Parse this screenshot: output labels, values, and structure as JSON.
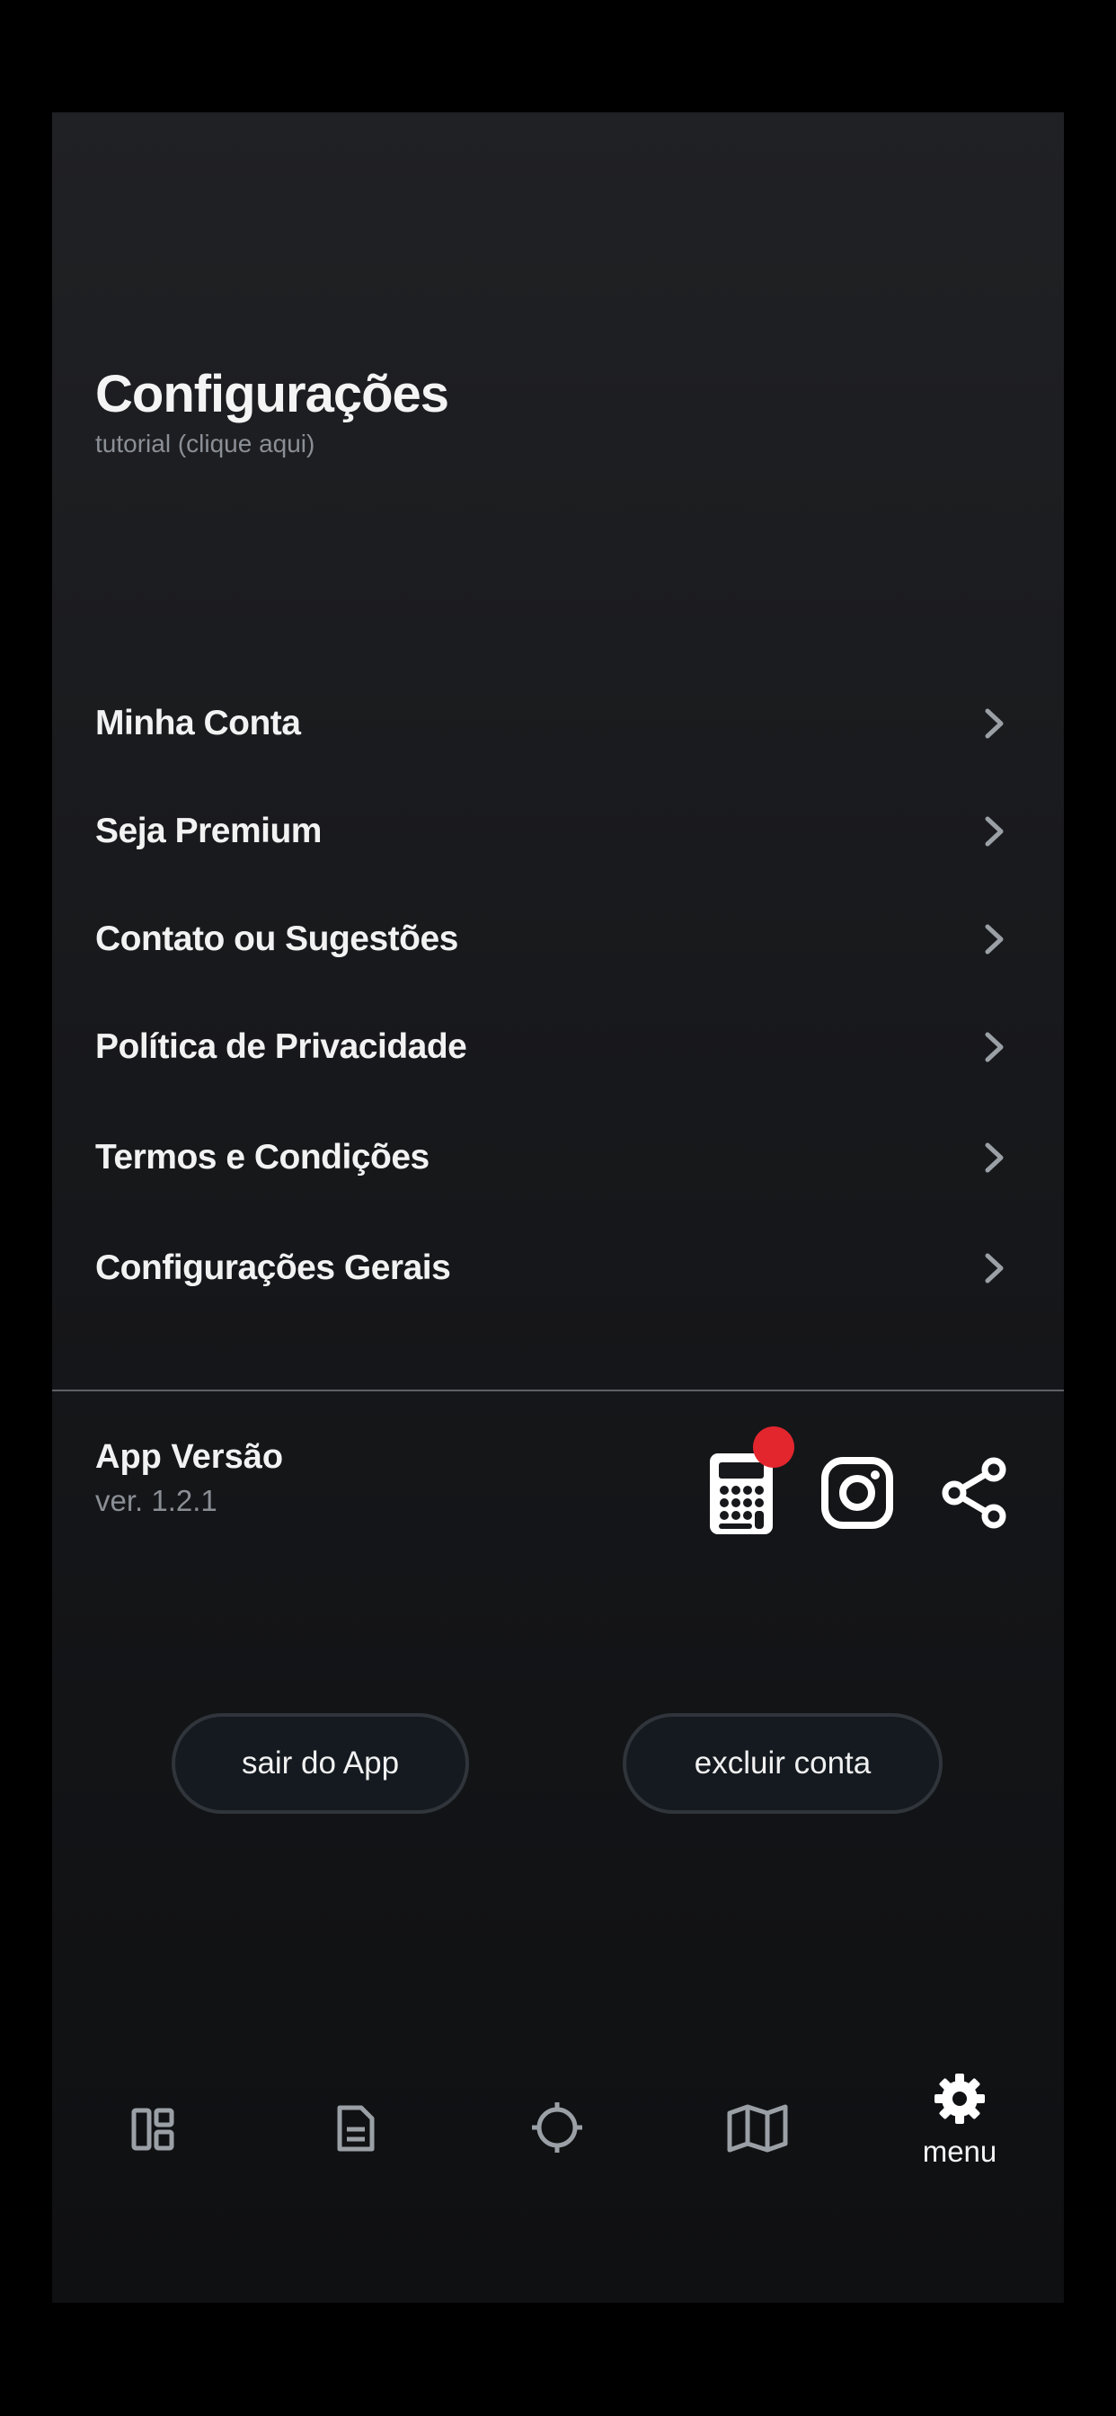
{
  "header": {
    "title": "Configurações",
    "subtitle": "tutorial (clique aqui)"
  },
  "menu": {
    "items": [
      {
        "label": "Minha Conta"
      },
      {
        "label": "Seja Premium"
      },
      {
        "label": "Contato ou Sugestões"
      },
      {
        "label": "Política de Privacidade"
      },
      {
        "label": "Termos e Condições"
      },
      {
        "label": "Configurações Gerais"
      }
    ]
  },
  "version": {
    "title": "App Versão",
    "value": "ver. 1.2.1"
  },
  "actions": {
    "logout_label": "sair do App",
    "delete_label": "excluir conta"
  },
  "social": {
    "icons": [
      "calculator-icon",
      "instagram-icon",
      "share-icon"
    ],
    "badge_color": "#e3262e"
  },
  "bottom_nav": {
    "items": [
      {
        "icon": "dashboard-icon"
      },
      {
        "icon": "document-icon"
      },
      {
        "icon": "crosshair-icon"
      },
      {
        "icon": "map-icon"
      },
      {
        "icon": "gear-icon",
        "label": "menu",
        "active": true
      }
    ]
  },
  "colors": {
    "background_top": "#202124",
    "background_bottom": "#0f1012",
    "text_primary": "#f2f2f3",
    "text_secondary": "#8a8e95",
    "chevron": "#9aa0a6"
  }
}
